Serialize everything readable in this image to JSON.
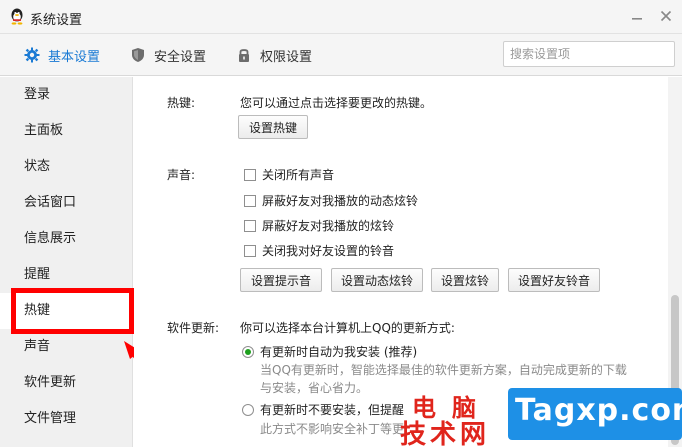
{
  "window": {
    "title": "系统设置"
  },
  "tabs": [
    {
      "label": "基本设置",
      "icon": "gear-icon"
    },
    {
      "label": "安全设置",
      "icon": "shield-icon"
    },
    {
      "label": "权限设置",
      "icon": "lock-icon"
    }
  ],
  "search": {
    "placeholder": "搜索设置项"
  },
  "sidebar": {
    "items": [
      {
        "label": "登录"
      },
      {
        "label": "主面板"
      },
      {
        "label": "状态"
      },
      {
        "label": "会话窗口"
      },
      {
        "label": "信息展示"
      },
      {
        "label": "提醒"
      },
      {
        "label": "热键"
      },
      {
        "label": "声音"
      },
      {
        "label": "软件更新"
      },
      {
        "label": "文件管理"
      }
    ],
    "selected": "热键"
  },
  "hotkey": {
    "label": "热键:",
    "desc": "您可以通过点击选择要更改的热键。",
    "button": "设置热键"
  },
  "sound": {
    "label": "声音:",
    "options": [
      {
        "label": "关闭所有声音",
        "checked": false
      },
      {
        "label": "屏蔽好友对我播放的动态炫铃",
        "checked": false
      },
      {
        "label": "屏蔽好友对我播放的炫铃",
        "checked": false
      },
      {
        "label": "关闭我对好友设置的铃音",
        "checked": false
      }
    ],
    "buttons": [
      "设置提示音",
      "设置动态炫铃",
      "设置炫铃",
      "设置好友铃音"
    ]
  },
  "update": {
    "label": "软件更新:",
    "desc": "你可以选择本台计算机上QQ的更新方式:",
    "options": [
      {
        "label": "有更新时自动为我安装 (推荐)",
        "note1": "当QQ有更新时，智能选择最佳的软件更新方案，自动完成更新的下载",
        "note2": "与安装，省心省力。",
        "selected": true
      },
      {
        "label": "有更新时不要安装，但提醒",
        "note1": "此方式不影响安全补丁等更",
        "selected": false
      }
    ]
  },
  "watermark": {
    "line1": "电脑",
    "line2": "技术网",
    "site": "Tagxp.com"
  },
  "colors": {
    "accent": "#1a7ad4",
    "highlight": "#ff0000",
    "radio_on": "#1ea01e"
  }
}
